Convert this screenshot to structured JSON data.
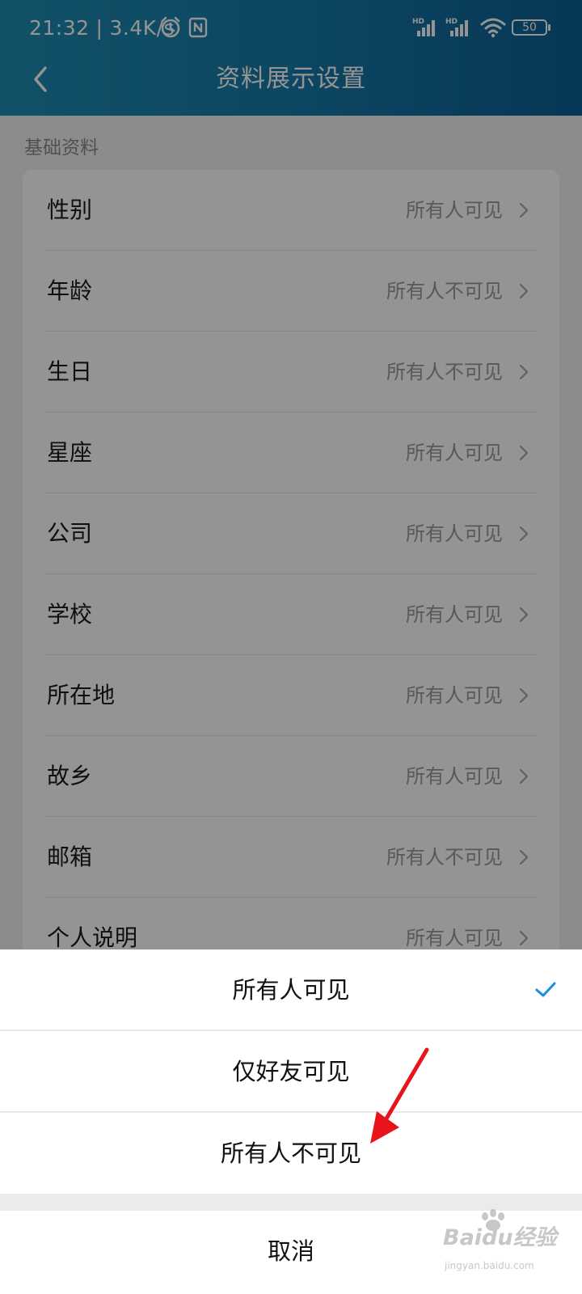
{
  "status_bar": {
    "time": "21:32",
    "separator": "|",
    "network_speed": "3.4K/s",
    "signal1_label": "HD",
    "signal2_label": "HD",
    "battery": "50",
    "icons": [
      "alarm-icon",
      "nfc-icon",
      "signal-icon",
      "signal-icon",
      "wifi-icon",
      "battery-icon"
    ]
  },
  "header": {
    "title": "资料展示设置",
    "back_icon": "chevron-left-icon",
    "gradient": [
      "#1f8cb3",
      "#0d5f95"
    ]
  },
  "section": {
    "label": "基础资料"
  },
  "rows": [
    {
      "label": "性别",
      "value": "所有人可见"
    },
    {
      "label": "年龄",
      "value": "所有人不可见"
    },
    {
      "label": "生日",
      "value": "所有人不可见"
    },
    {
      "label": "星座",
      "value": "所有人可见"
    },
    {
      "label": "公司",
      "value": "所有人可见"
    },
    {
      "label": "学校",
      "value": "所有人可见"
    },
    {
      "label": "所在地",
      "value": "所有人可见"
    },
    {
      "label": "故乡",
      "value": "所有人可见"
    },
    {
      "label": "邮箱",
      "value": "所有人不可见"
    },
    {
      "label": "个人说明",
      "value": "所有人可见"
    }
  ],
  "sheet": {
    "options": [
      {
        "label": "所有人可见",
        "selected": true
      },
      {
        "label": "仅好友可见",
        "selected": false
      },
      {
        "label": "所有人不可见",
        "selected": false
      }
    ],
    "cancel": "取消",
    "check_color": "#1a8de0"
  },
  "annotation": {
    "color": "#e8141b"
  },
  "watermark": {
    "text": "Baidu经验",
    "sub": "jingyan.baidu.com"
  }
}
